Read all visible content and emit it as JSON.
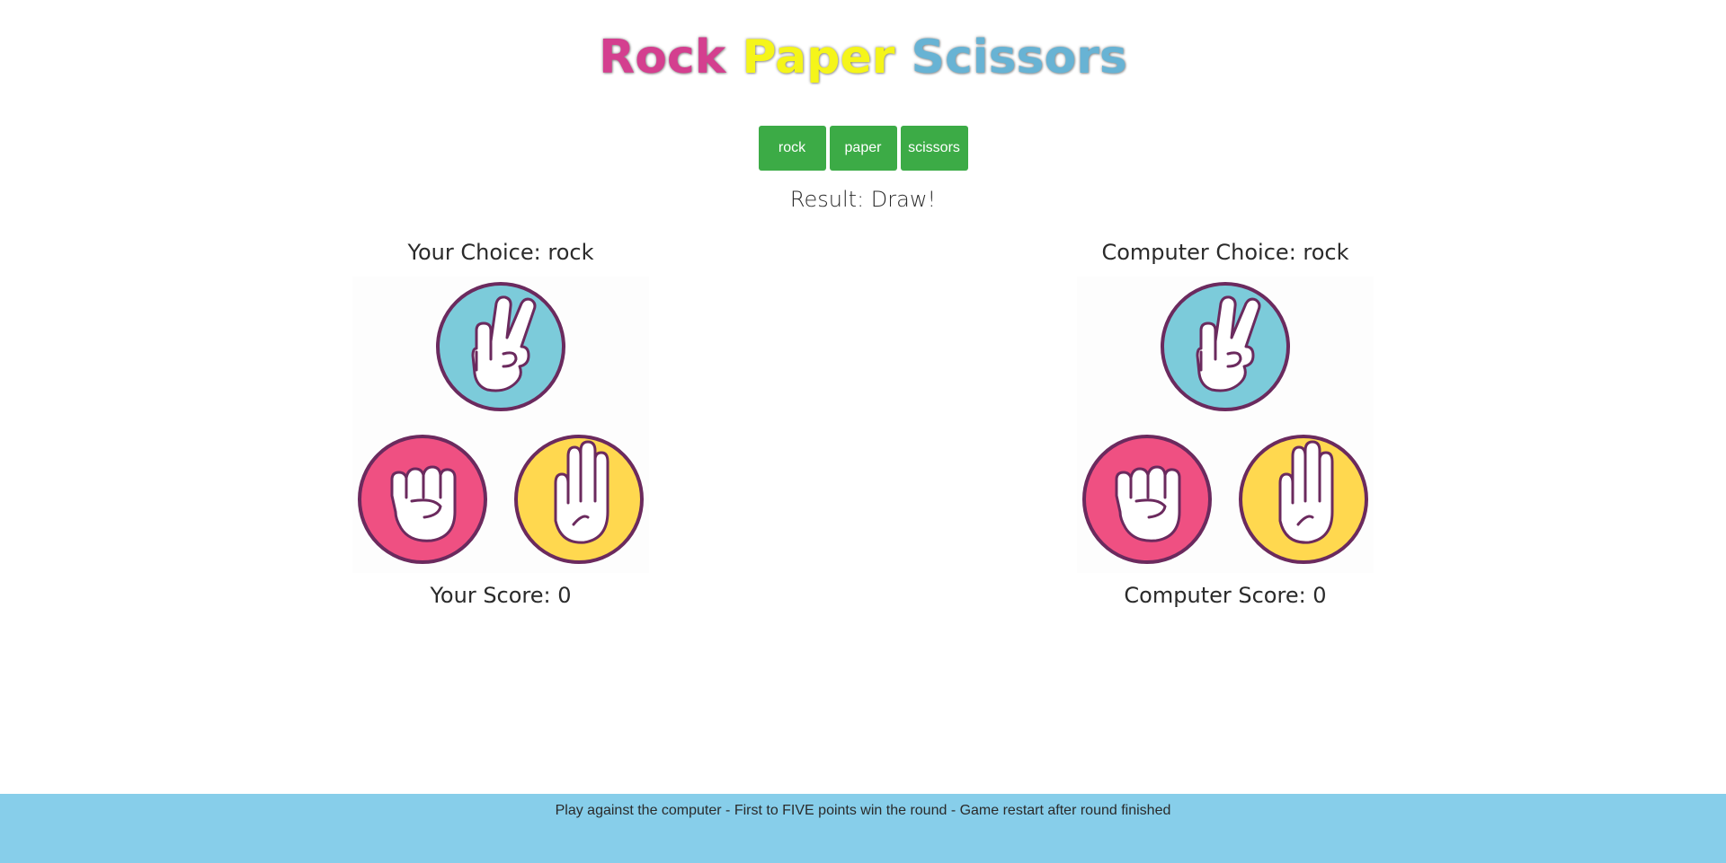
{
  "title": {
    "word1": "Rock",
    "word2": "Paper",
    "word3": "Scissors"
  },
  "buttons": {
    "rock": "rock",
    "paper": "paper",
    "scissors": "scissors"
  },
  "result": "Result: Draw!",
  "player": {
    "choice": "Your Choice: rock",
    "score": "Your Score: 0"
  },
  "computer": {
    "choice": "Computer Choice: rock",
    "score": "Computer Score: 0"
  },
  "footer": "Play against the computer - First to FIVE points win the round - Game restart after round finished",
  "colors": {
    "rock": "#d43f8f",
    "paper": "#f5f51a",
    "scissors": "#68b3d4",
    "button": "#3cab46",
    "footer": "#87ceea",
    "rock_circle": "#ef5082",
    "paper_circle": "#ffd84f",
    "scissors_circle": "#7ccbda",
    "outline": "#6b2a5e"
  },
  "icons": [
    "scissors-hand-icon",
    "rock-hand-icon",
    "paper-hand-icon"
  ]
}
